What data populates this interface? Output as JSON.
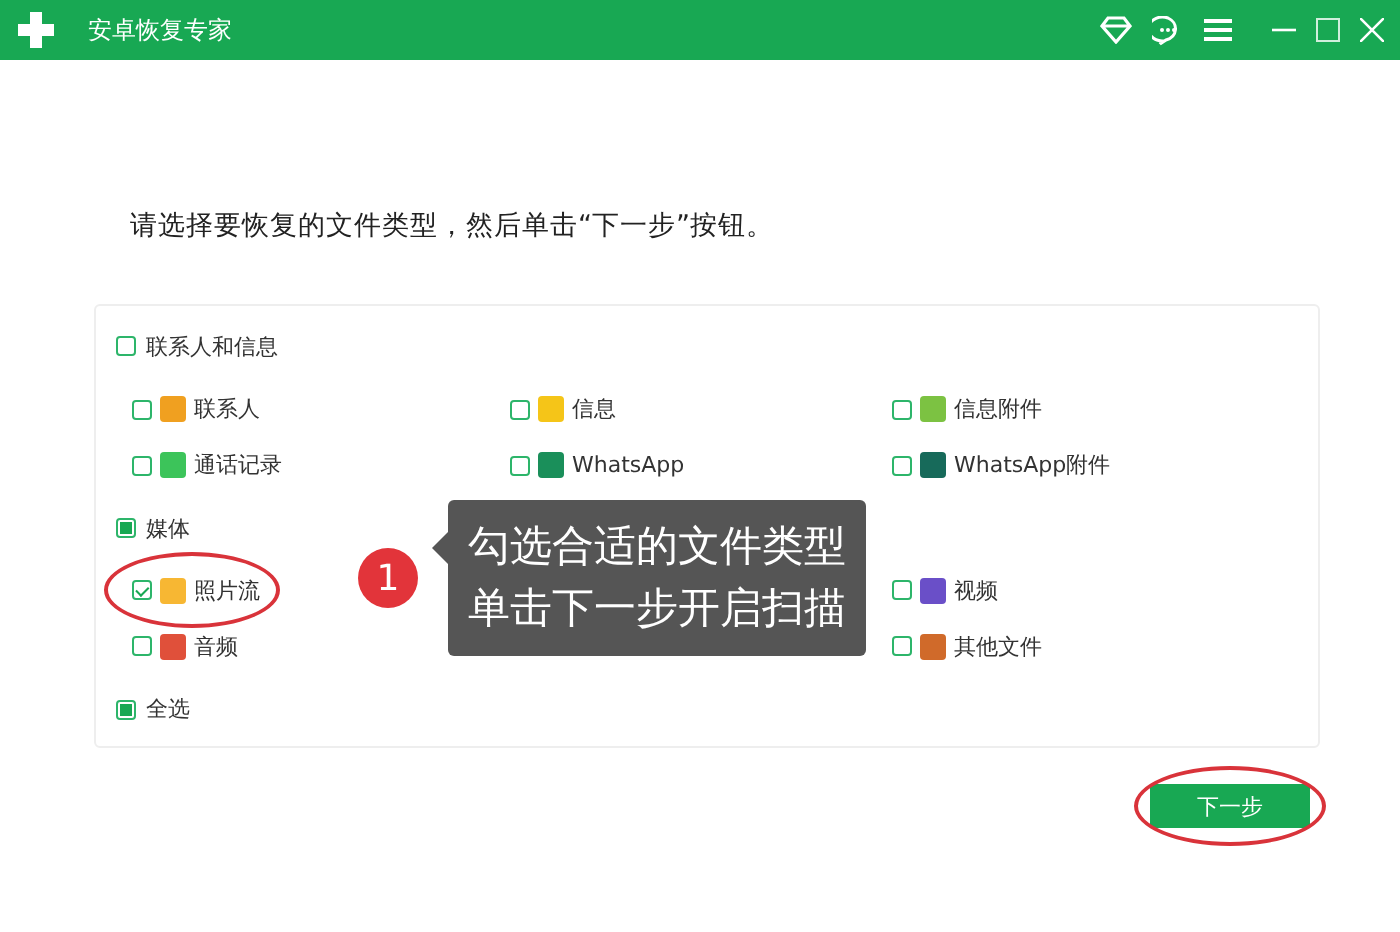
{
  "window": {
    "title": "安卓恢复专家"
  },
  "instruction": "请选择要恢复的文件类型，然后单击“下一步”按钮。",
  "groups": [
    {
      "label": "联系人和信息",
      "checked": false,
      "partial": false,
      "items": [
        {
          "label": "联系人",
          "checked": false,
          "color": "#f0a020"
        },
        {
          "label": "信息",
          "checked": false,
          "color": "#f5c518"
        },
        {
          "label": "信息附件",
          "checked": false,
          "color": "#7cc242"
        },
        {
          "label": "通话记录",
          "checked": false,
          "color": "#3cc45a"
        },
        {
          "label": "WhatsApp",
          "checked": false,
          "color": "#1a8f5a"
        },
        {
          "label": "WhatsApp附件",
          "checked": false,
          "color": "#176a5a"
        }
      ]
    },
    {
      "label": "媒体",
      "checked": false,
      "partial": true,
      "items": [
        {
          "label": "照片流",
          "checked": true,
          "color": "#f7b733",
          "circled": true
        },
        {
          "kind": "covered"
        },
        {
          "label": "视频",
          "checked": false,
          "color": "#6a4fc8"
        },
        {
          "label": "音频",
          "checked": false,
          "color": "#e0503a"
        },
        {
          "kind": "covered"
        },
        {
          "label": "其他文件",
          "checked": false,
          "color": "#d06a2a"
        }
      ]
    }
  ],
  "select_all": {
    "label": "全选",
    "checked": false,
    "partial": true
  },
  "callout": {
    "number": "1",
    "lines": [
      "勾选合适的文件类型",
      "单击下一步开启扫描"
    ]
  },
  "next_button": {
    "label": "下一步",
    "circled": true
  }
}
